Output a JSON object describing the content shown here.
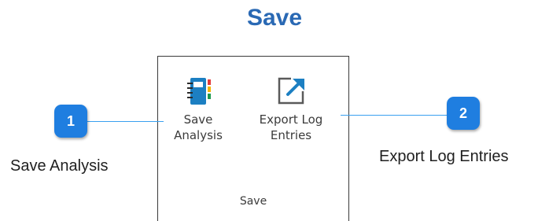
{
  "page": {
    "title": "Save"
  },
  "ribbon": {
    "group_label": "Save",
    "buttons": [
      {
        "line1": "Save",
        "line2": "Analysis",
        "icon": "save-notebook-icon"
      },
      {
        "line1": "Export Log",
        "line2": "Entries",
        "icon": "export-icon"
      }
    ]
  },
  "callouts": [
    {
      "number": "1",
      "caption": "Save Analysis"
    },
    {
      "number": "2",
      "caption": "Export Log Entries"
    }
  ],
  "colors": {
    "title": "#2a69b4",
    "callout": "#1f7ee0",
    "connector": "#3aa0f0"
  }
}
